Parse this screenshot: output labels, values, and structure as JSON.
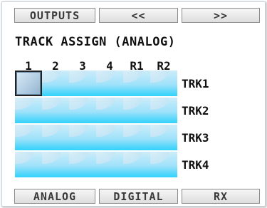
{
  "top_bar": {
    "outputs_label": "OUTPUTS",
    "prev_label": "<<",
    "next_label": ">>"
  },
  "panel": {
    "title": "TRACK ASSIGN (ANALOG)",
    "columns": [
      "1",
      "2",
      "3",
      "4",
      "R1",
      "R2"
    ],
    "rows": [
      "TRK1",
      "TRK2",
      "TRK3",
      "TRK4"
    ],
    "selected_cell": {
      "row": "TRK1",
      "column": "1"
    }
  },
  "bottom_bar": {
    "analog_label": "ANALOG",
    "digital_label": "DIGITAL",
    "rx_label": "RX"
  },
  "colors": {
    "cell_light": "#ccecf9",
    "cell_cyan": "#30d2fc",
    "selected_cell": "#b3cde2"
  }
}
